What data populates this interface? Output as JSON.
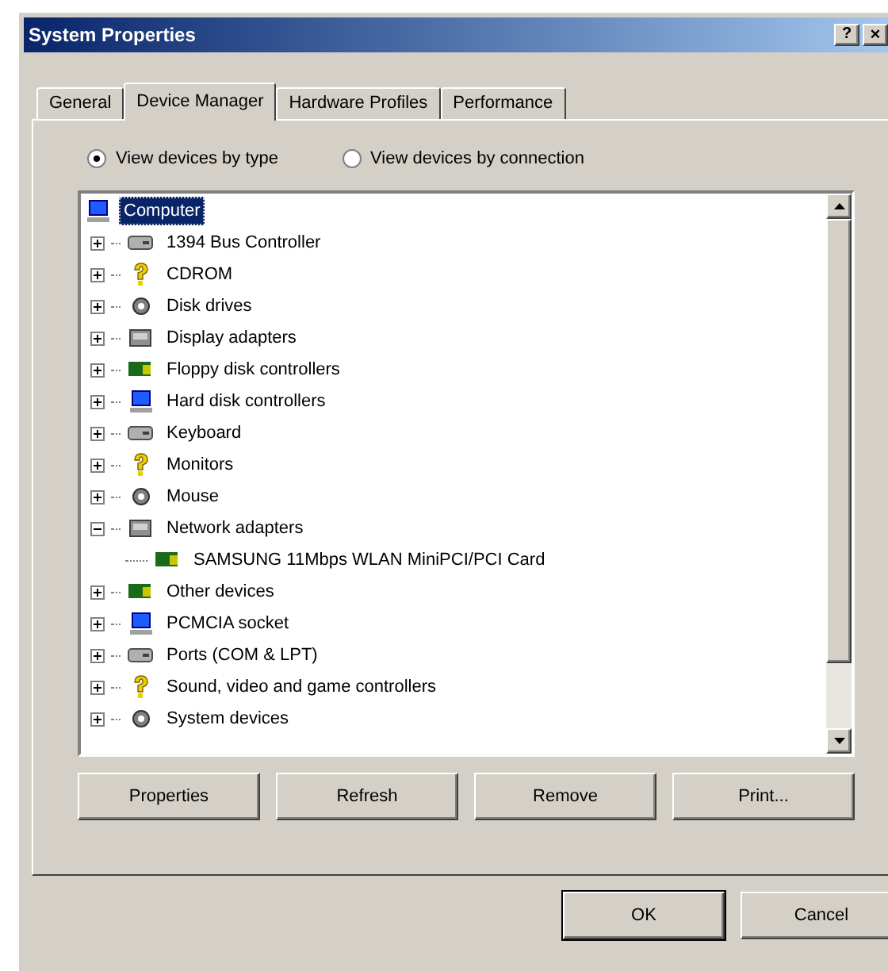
{
  "window": {
    "title": "System Properties",
    "help_button": "?",
    "close_button": "×"
  },
  "tabs": [
    {
      "label": "General",
      "selected": false
    },
    {
      "label": "Device Manager",
      "selected": true
    },
    {
      "label": "Hardware Profiles",
      "selected": false
    },
    {
      "label": "Performance",
      "selected": false
    }
  ],
  "view_options": [
    {
      "label": "View devices by type",
      "selected": true
    },
    {
      "label": "View devices by connection",
      "selected": false
    }
  ],
  "tree": {
    "label": "Computer",
    "selected": true,
    "children": [
      {
        "label": "1394 Bus Controller",
        "selected": false,
        "expanded": false
      },
      {
        "label": "CDROM",
        "selected": false,
        "expanded": false
      },
      {
        "label": "Disk drives",
        "selected": false,
        "expanded": false
      },
      {
        "label": "Display adapters",
        "selected": false,
        "expanded": false
      },
      {
        "label": "Floppy disk controllers",
        "selected": false,
        "expanded": false
      },
      {
        "label": "Hard disk controllers",
        "selected": false,
        "expanded": false
      },
      {
        "label": "Keyboard",
        "selected": false,
        "expanded": false
      },
      {
        "label": "Monitors",
        "selected": false,
        "expanded": false
      },
      {
        "label": "Mouse",
        "selected": false,
        "expanded": false
      },
      {
        "label": "Network adapters",
        "selected": false,
        "expanded": true,
        "children": [
          {
            "label": "SAMSUNG 11Mbps WLAN MiniPCI/PCI Card",
            "selected": false
          }
        ]
      },
      {
        "label": "Other devices",
        "selected": false,
        "expanded": false
      },
      {
        "label": "PCMCIA socket",
        "selected": false,
        "expanded": false
      },
      {
        "label": "Ports (COM & LPT)",
        "selected": false,
        "expanded": false
      },
      {
        "label": "Sound, video and game controllers",
        "selected": false,
        "expanded": false
      },
      {
        "label": "System devices",
        "selected": false,
        "expanded": false
      }
    ]
  },
  "action_buttons": [
    "Properties",
    "Refresh",
    "Remove",
    "Print..."
  ],
  "dialog_buttons": [
    {
      "label": "OK",
      "default": true
    },
    {
      "label": "Cancel",
      "default": false
    }
  ]
}
